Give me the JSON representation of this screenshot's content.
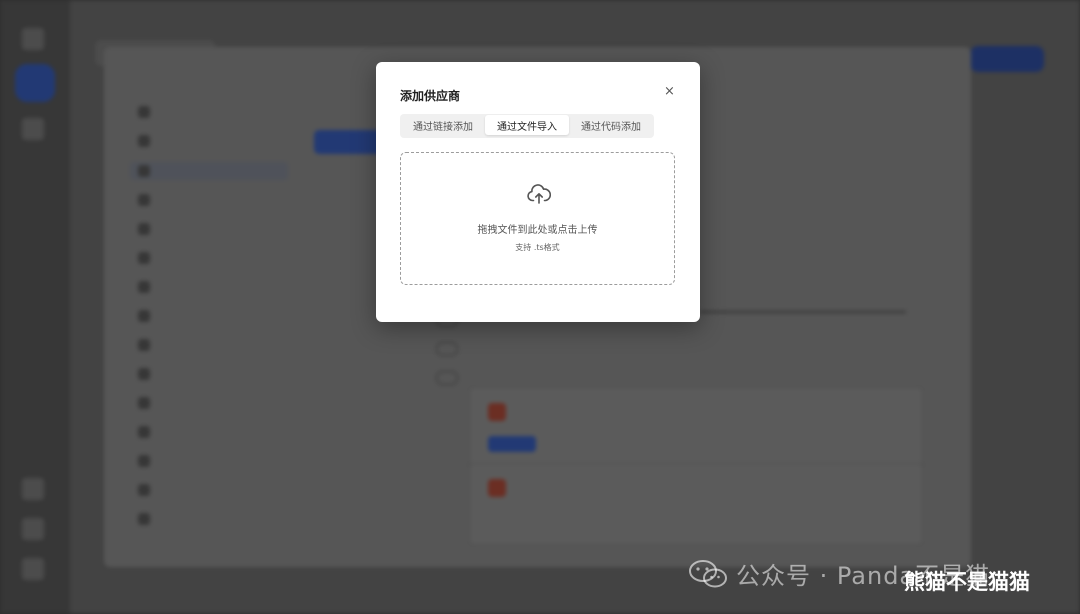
{
  "modal": {
    "title": "添加供应商",
    "close_glyph": "×",
    "tabs": [
      {
        "label": "通过链接添加",
        "active": false
      },
      {
        "label": "通过文件导入",
        "active": true
      },
      {
        "label": "通过代码添加",
        "active": false
      }
    ],
    "dropzone": {
      "icon": "cloud-upload-icon",
      "main_text": "拖拽文件到此处或点击上传",
      "sub_text": "支持 .ts格式"
    }
  },
  "watermark": {
    "icon": "wechat-icon",
    "text": "公众号 · Panda不是猫",
    "overlay_text": "熊猫不是猫猫"
  }
}
